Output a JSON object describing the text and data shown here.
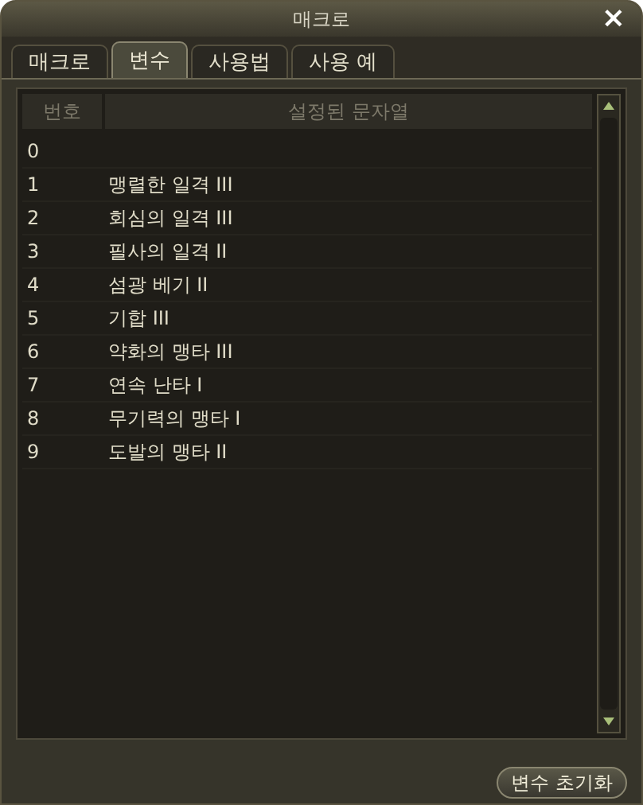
{
  "window": {
    "title": "매크로",
    "close": "×"
  },
  "tabs": [
    {
      "label": "매크로",
      "selected": false
    },
    {
      "label": "변수",
      "selected": true
    },
    {
      "label": "사용법",
      "selected": false
    },
    {
      "label": "사용 예",
      "selected": false
    }
  ],
  "table": {
    "columns": [
      "번호",
      "설정된 문자열"
    ],
    "rows": [
      [
        "0",
        ""
      ],
      [
        "1",
        "맹렬한 일격 III"
      ],
      [
        "2",
        "회심의 일격 III"
      ],
      [
        "3",
        "필사의 일격 II"
      ],
      [
        "4",
        "섬광 베기 II"
      ],
      [
        "5",
        "기합 III"
      ],
      [
        "6",
        "약화의 맹타 III"
      ],
      [
        "7",
        "연속 난타 I"
      ],
      [
        "8",
        "무기력의 맹타 I"
      ],
      [
        "9",
        "도발의 맹타 II"
      ]
    ]
  },
  "footer": {
    "button": "변수 초기화"
  }
}
